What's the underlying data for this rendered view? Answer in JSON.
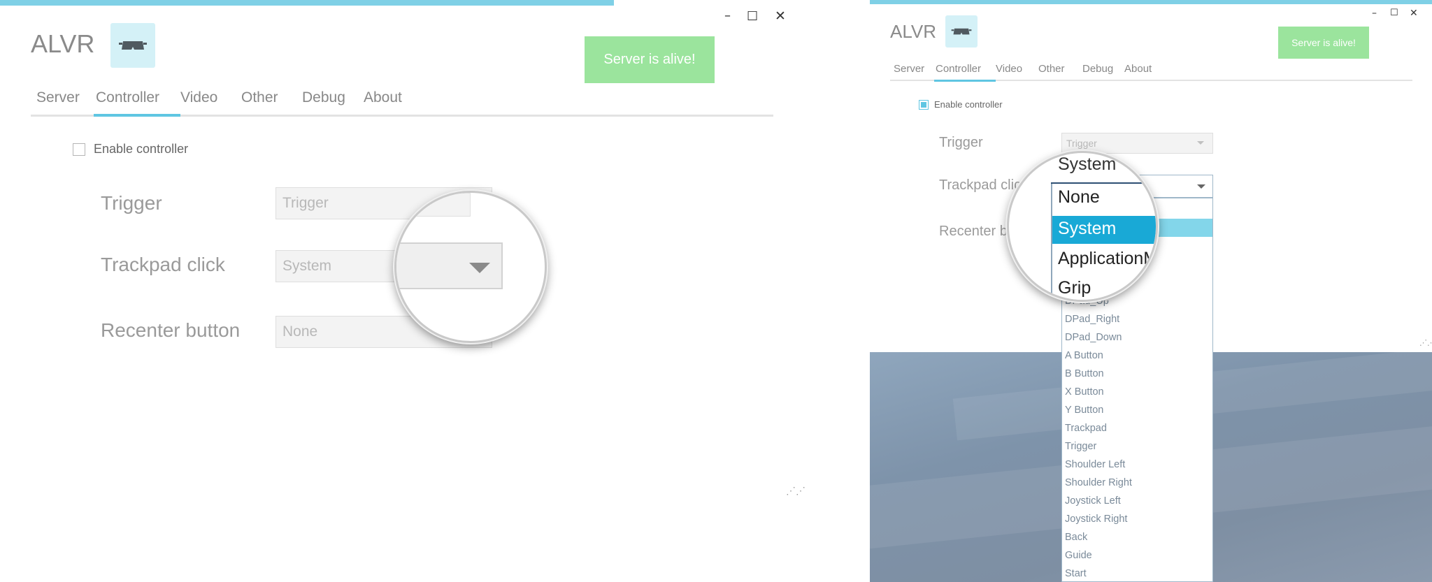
{
  "window": {
    "title": "ALVR",
    "status": "Server is alive!",
    "controls": {
      "minimize": "–",
      "maximize": "☐",
      "close": "✕"
    }
  },
  "tabs": [
    "Server",
    "Controller",
    "Video",
    "Other",
    "Debug",
    "About"
  ],
  "active_tab": "Controller",
  "controller": {
    "enable_label": "Enable controller",
    "trigger_label": "Trigger",
    "trigger_value": "Trigger",
    "trackpad_label": "Trackpad click",
    "trackpad_value": "System",
    "recenter_label": "Recenter button",
    "recenter_value": "None",
    "recenter_label_partial": "Recenter bu",
    "trackpad_label_partial": "Trackpad clic"
  },
  "dropdown": {
    "selected": "System",
    "options": [
      "DPad_Up",
      "DPad_Right",
      "DPad_Down",
      "A Button",
      "B Button",
      "X Button",
      "Y Button",
      "Trackpad",
      "Trigger",
      "Shoulder Left",
      "Shoulder Right",
      "Joystick Left",
      "Joystick Right",
      "Back",
      "Guide",
      "Start"
    ],
    "magnified": {
      "header": "System",
      "items": [
        "None",
        "System",
        "ApplicationM",
        "Grip"
      ]
    }
  },
  "icons": {
    "logo": "vr-headset-icon",
    "checkbox": "checkbox-icon",
    "dropdown": "chevron-down-icon",
    "resize": "resize-grip-icon"
  },
  "colors": {
    "accent": "#5fc6e2",
    "status_bg": "#9be49d",
    "selected_option": "#19a9d6"
  }
}
